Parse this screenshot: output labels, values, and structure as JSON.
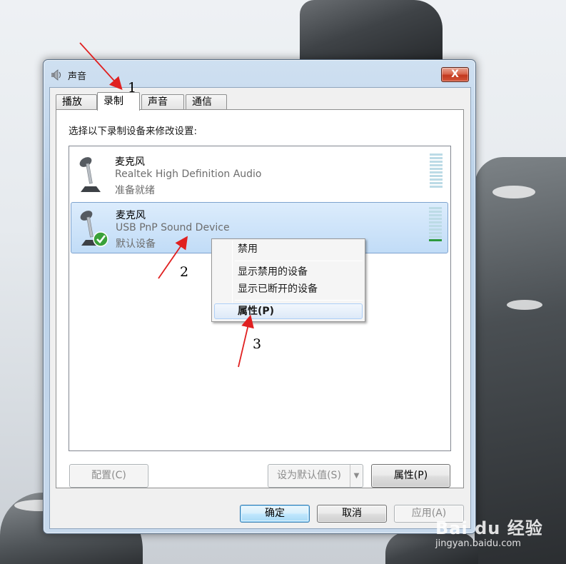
{
  "window": {
    "title": "声音",
    "close_label": "X"
  },
  "tabs": [
    {
      "label": "播放",
      "active": false
    },
    {
      "label": "录制",
      "active": true
    },
    {
      "label": "声音",
      "active": false
    },
    {
      "label": "通信",
      "active": false
    }
  ],
  "instruction": "选择以下录制设备来修改设置:",
  "devices": [
    {
      "name": "麦克风",
      "description": "Realtek High Definition Audio",
      "status": "准备就绪",
      "selected": false,
      "is_default": false,
      "meter_level": 0
    },
    {
      "name": "麦克风",
      "description": "USB PnP Sound Device",
      "status": "默认设备",
      "selected": true,
      "is_default": true,
      "meter_level": 0.1
    }
  ],
  "context_menu": {
    "items": [
      {
        "label": "禁用"
      },
      {
        "label": "显示禁用的设备"
      },
      {
        "label": "显示已断开的设备"
      },
      {
        "label": "属性(P)",
        "highlighted": true
      }
    ]
  },
  "buttons": {
    "configure": "配置(C)",
    "set_default": "设为默认值(S)",
    "properties": "属性(P)",
    "ok": "确定",
    "cancel": "取消",
    "apply": "应用(A)"
  },
  "annotations": [
    "1",
    "2",
    "3"
  ],
  "watermark": {
    "logo": "Bai du 经验",
    "url": "jingyan.baidu.com"
  },
  "colors": {
    "selection": "#c1dcf7",
    "meter_active": "#2e9a3e",
    "arrow": "#e02020",
    "close_button": "#c2391f"
  }
}
